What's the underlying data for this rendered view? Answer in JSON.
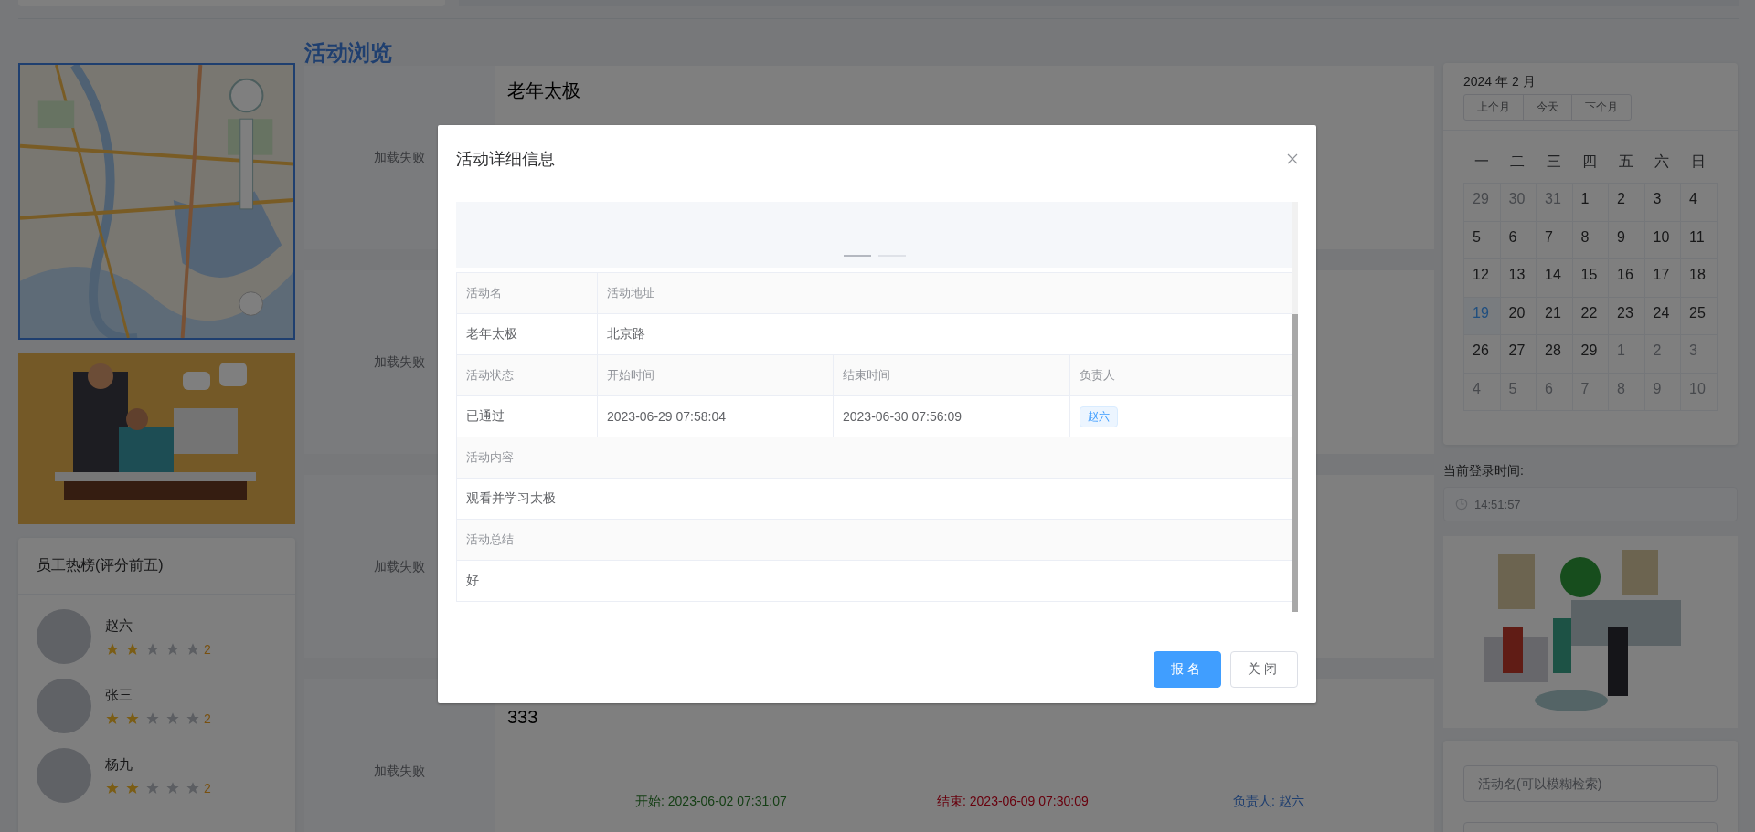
{
  "page_heading": "活动浏览",
  "ranking": {
    "title": "员工热榜(评分前五)",
    "employees": [
      {
        "name": "赵六",
        "stars": 2,
        "score": "2"
      },
      {
        "name": "张三",
        "stars": 2,
        "score": "2"
      },
      {
        "name": "杨九",
        "stars": 2,
        "score": "2"
      }
    ]
  },
  "activities": [
    {
      "title": "老年太极",
      "image_status": "加载失败"
    },
    {
      "image_status": "加载失败"
    },
    {
      "image_status": "加载失败"
    },
    {
      "title": "333",
      "image_status": "加载失败",
      "start": "开始: 2023-06-02 07:31:07",
      "end": "结束: 2023-06-09 07:30:09",
      "owner": "负责人: 赵六"
    }
  ],
  "calendar": {
    "title": "2024 年 2 月",
    "buttons": [
      "上个月",
      "今天",
      "下个月"
    ],
    "weekdays": [
      "一",
      "二",
      "三",
      "四",
      "五",
      "六",
      "日"
    ],
    "days": [
      {
        "label": "29",
        "other_month": true,
        "selected": false
      },
      {
        "label": "30",
        "other_month": true,
        "selected": false
      },
      {
        "label": "31",
        "other_month": true,
        "selected": false
      },
      {
        "label": "1",
        "other_month": false,
        "selected": false
      },
      {
        "label": "2",
        "other_month": false,
        "selected": false
      },
      {
        "label": "3",
        "other_month": false,
        "selected": false
      },
      {
        "label": "4",
        "other_month": false,
        "selected": false
      },
      {
        "label": "5",
        "other_month": false,
        "selected": false
      },
      {
        "label": "6",
        "other_month": false,
        "selected": false
      },
      {
        "label": "7",
        "other_month": false,
        "selected": false
      },
      {
        "label": "8",
        "other_month": false,
        "selected": false
      },
      {
        "label": "9",
        "other_month": false,
        "selected": false
      },
      {
        "label": "10",
        "other_month": false,
        "selected": false
      },
      {
        "label": "11",
        "other_month": false,
        "selected": false
      },
      {
        "label": "12",
        "other_month": false,
        "selected": false
      },
      {
        "label": "13",
        "other_month": false,
        "selected": false
      },
      {
        "label": "14",
        "other_month": false,
        "selected": false
      },
      {
        "label": "15",
        "other_month": false,
        "selected": false
      },
      {
        "label": "16",
        "other_month": false,
        "selected": false
      },
      {
        "label": "17",
        "other_month": false,
        "selected": false
      },
      {
        "label": "18",
        "other_month": false,
        "selected": false
      },
      {
        "label": "19",
        "other_month": false,
        "selected": true
      },
      {
        "label": "20",
        "other_month": false,
        "selected": false
      },
      {
        "label": "21",
        "other_month": false,
        "selected": false
      },
      {
        "label": "22",
        "other_month": false,
        "selected": false
      },
      {
        "label": "23",
        "other_month": false,
        "selected": false
      },
      {
        "label": "24",
        "other_month": false,
        "selected": false
      },
      {
        "label": "25",
        "other_month": false,
        "selected": false
      },
      {
        "label": "26",
        "other_month": false,
        "selected": false
      },
      {
        "label": "27",
        "other_month": false,
        "selected": false
      },
      {
        "label": "28",
        "other_month": false,
        "selected": false
      },
      {
        "label": "29",
        "other_month": false,
        "selected": false
      },
      {
        "label": "1",
        "other_month": true,
        "selected": false
      },
      {
        "label": "2",
        "other_month": true,
        "selected": false
      },
      {
        "label": "3",
        "other_month": true,
        "selected": false
      },
      {
        "label": "4",
        "other_month": true,
        "selected": false
      },
      {
        "label": "5",
        "other_month": true,
        "selected": false
      },
      {
        "label": "6",
        "other_month": true,
        "selected": false
      },
      {
        "label": "7",
        "other_month": true,
        "selected": false
      },
      {
        "label": "8",
        "other_month": true,
        "selected": false
      },
      {
        "label": "9",
        "other_month": true,
        "selected": false
      },
      {
        "label": "10",
        "other_month": true,
        "selected": false
      }
    ]
  },
  "login_time": {
    "label": "当前登录时间:",
    "value": "14:51:57"
  },
  "search": {
    "fields": [
      {
        "placeholder": "活动名(可以模糊检索)"
      }
    ]
  },
  "dialog": {
    "title": "活动详细信息",
    "carousel": {
      "indicators": [
        {
          "selected": true
        },
        {
          "selected": false
        }
      ]
    },
    "rows": [
      {
        "kind": "label",
        "cells": [
          {
            "text": "活动名"
          },
          {
            "text": "活动地址"
          }
        ]
      },
      {
        "kind": "value",
        "cells": [
          {
            "text": "老年太极"
          },
          {
            "text": "北京路"
          }
        ]
      },
      {
        "kind": "label",
        "cells": [
          {
            "text": "活动状态"
          },
          {
            "text": "开始时间"
          },
          {
            "text": "结束时间"
          },
          {
            "text": "负责人"
          }
        ]
      },
      {
        "kind": "value",
        "cells": [
          {
            "text": "已通过"
          },
          {
            "text": "2023-06-29 07:58:04"
          },
          {
            "text": "2023-06-30 07:56:09"
          },
          {
            "text": "赵六",
            "kind": "tag"
          }
        ]
      },
      {
        "kind": "label",
        "cells": [
          {
            "text": "活动内容"
          }
        ]
      },
      {
        "kind": "value",
        "cells": [
          {
            "text": "观看并学习太极"
          }
        ]
      },
      {
        "kind": "label",
        "cells": [
          {
            "text": "活动总结"
          }
        ]
      },
      {
        "kind": "value",
        "cells": [
          {
            "text": "好"
          }
        ]
      }
    ],
    "buttons": [
      {
        "label": "报名",
        "kind": "primary"
      },
      {
        "label": "关闭",
        "kind": "default"
      }
    ]
  }
}
